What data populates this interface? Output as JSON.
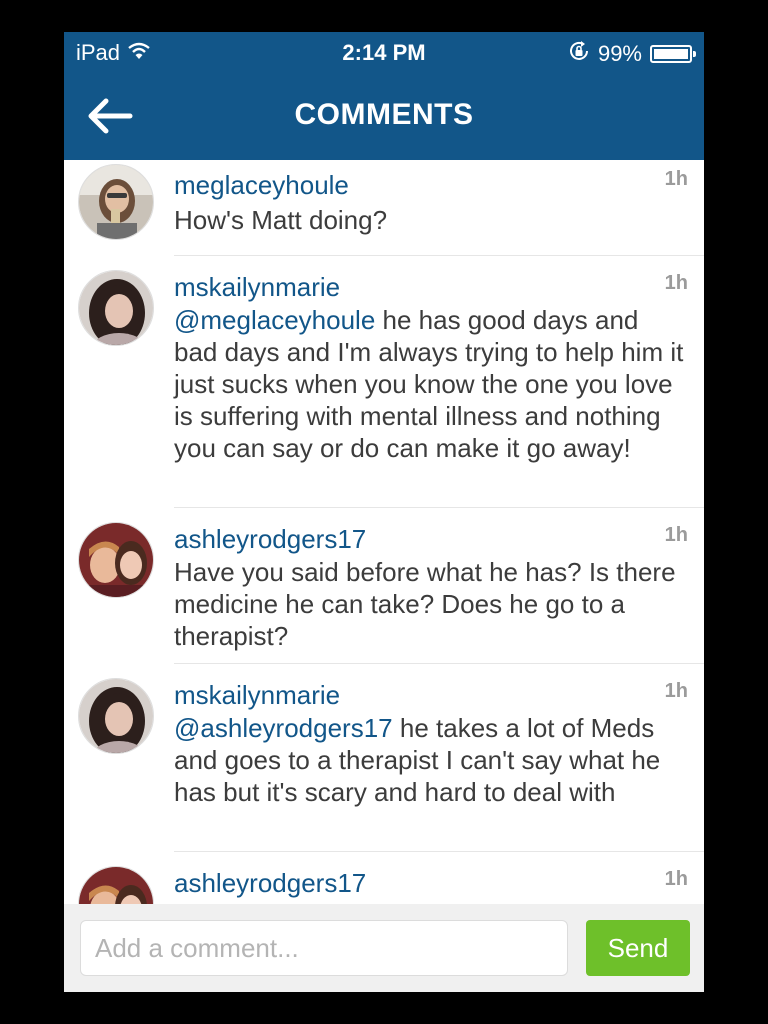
{
  "status_bar": {
    "device": "iPad",
    "time": "2:14 PM",
    "battery": "99%",
    "battery_level": 0.99
  },
  "nav": {
    "title": "COMMENTS"
  },
  "comments": [
    {
      "user": "meglaceyhoule",
      "time": "1h",
      "mention": "",
      "text": "How's Matt doing?"
    },
    {
      "user": "mskailynmarie",
      "time": "1h",
      "mention": "@meglaceyhoule",
      "text": " he has good days and bad days and I'm always trying to help him it just sucks when you know the one you love is suffering with mental illness and nothing you can say or do can make it go away!"
    },
    {
      "user": "ashleyrodgers17",
      "time": "1h",
      "mention": "",
      "text": "Have you said before what he has? Is there medicine he can take? Does he go to a therapist?"
    },
    {
      "user": "mskailynmarie",
      "time": "1h",
      "mention": "@ashleyrodgers17",
      "text": " he takes a lot of Meds and goes to a therapist I can't say what he has but it's scary and hard to deal with"
    },
    {
      "user": "ashleyrodgers17",
      "time": "1h",
      "mention": "",
      "text": ""
    }
  ],
  "composer": {
    "placeholder": "Add a comment...",
    "value": "",
    "send_label": "Send"
  },
  "colors": {
    "brand": "#125689",
    "send": "#6ec02a",
    "time": "#9b9b9b"
  }
}
